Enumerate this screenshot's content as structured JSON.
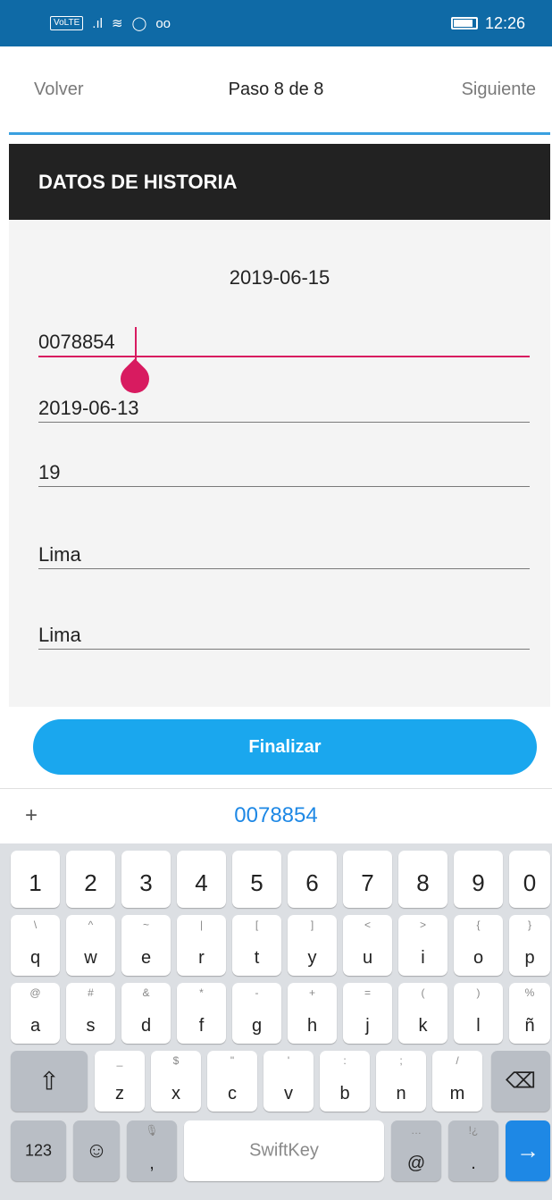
{
  "status": {
    "time": "12:26",
    "badge": "VoLTE",
    "signal": ".ıl",
    "wifi": "≋",
    "whatsapp": "◯",
    "voicemail": "oo"
  },
  "nav": {
    "back": "Volver",
    "title": "Paso 8 de 8",
    "next": "Siguiente"
  },
  "section": {
    "title": "DATOS DE HISTORIA"
  },
  "form": {
    "date": "2019-06-15",
    "fields": [
      "0078854",
      "2019-06-13",
      "19",
      "Lima",
      "Lima"
    ]
  },
  "finish": {
    "label": "Finalizar"
  },
  "suggest": {
    "plus": "+",
    "word": "0078854"
  },
  "keyboard": {
    "numbers": [
      "1",
      "2",
      "3",
      "4",
      "5",
      "6",
      "7",
      "8",
      "9",
      "0"
    ],
    "row1": [
      [
        "q",
        "\\"
      ],
      [
        "w",
        "^"
      ],
      [
        "e",
        "~"
      ],
      [
        "r",
        "|"
      ],
      [
        "t",
        "["
      ],
      [
        "y",
        "]"
      ],
      [
        "u",
        "<"
      ],
      [
        "i",
        ">"
      ],
      [
        "o",
        "{"
      ],
      [
        "p",
        "}"
      ]
    ],
    "row2": [
      [
        "a",
        "@"
      ],
      [
        "s",
        "#"
      ],
      [
        "d",
        "&"
      ],
      [
        "f",
        "*"
      ],
      [
        "g",
        "-"
      ],
      [
        "h",
        "+"
      ],
      [
        "j",
        "="
      ],
      [
        "k",
        "("
      ],
      [
        "l",
        ")"
      ],
      [
        "ñ",
        "%"
      ]
    ],
    "row3": [
      [
        "z",
        "_"
      ],
      [
        "x",
        "$"
      ],
      [
        "c",
        "\""
      ],
      [
        "v",
        "'"
      ],
      [
        "b",
        ":"
      ],
      [
        "n",
        ";"
      ],
      [
        "m",
        "/"
      ]
    ],
    "shift": "⇧",
    "backspace": "⌫",
    "num_key": "123",
    "emoji": "☺",
    "comma": ",",
    "comma_sub": "🎙",
    "space": "SwiftKey",
    "at": "@",
    "at_sub": "…",
    "period": ".",
    "period_sub": "!¿",
    "enter": "→"
  }
}
